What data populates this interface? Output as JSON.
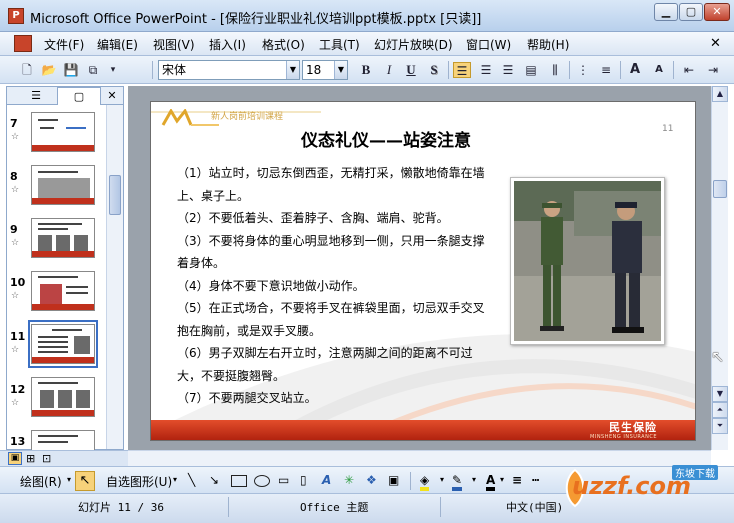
{
  "window": {
    "title": "Microsoft Office PowerPoint - [保险行业职业礼仪培训ppt模板.pptx [只读]]",
    "app_icon": "P"
  },
  "menu": {
    "items": [
      "文件(F)",
      "编辑(E)",
      "视图(V)",
      "插入(I)",
      "格式(O)",
      "工具(T)",
      "幻灯片放映(D)",
      "窗口(W)",
      "帮助(H)"
    ]
  },
  "toolbar": {
    "font_name": "宋体",
    "font_size": "18",
    "bold": "B",
    "italic": "I",
    "underline": "U",
    "shadow": "S",
    "grow_font": "A",
    "shrink_font": "A"
  },
  "left_pane": {
    "tab_outline": "☰",
    "tab_slides": "▢",
    "slides": [
      {
        "num": "7",
        "star": "☆"
      },
      {
        "num": "8",
        "star": "☆"
      },
      {
        "num": "9",
        "star": "☆"
      },
      {
        "num": "10",
        "star": "☆"
      },
      {
        "num": "11",
        "star": "☆"
      },
      {
        "num": "12",
        "star": "☆"
      },
      {
        "num": "13",
        "star": ""
      }
    ]
  },
  "slide": {
    "header_text": "新人岗前培训课程",
    "title": "仪态礼仪——站姿注意",
    "page_number": "11",
    "body": [
      "（1）站立时，切忌东倒西歪，无精打采，懒散地倚靠在墙上、桌子上。",
      "（2）不要低着头、歪着脖子、含胸、端肩、驼背。",
      "（3）不要将身体的重心明显地移到一侧，只用一条腿支撑着身体。",
      "（4）身体不要下意识地做小动作。",
      "（5）在正式场合，不要将手叉在裤袋里面，切忌双手交叉抱在胸前，或是双手叉腰。",
      "（6）男子双脚左右开立时，注意两脚之间的距离不可过大，不要挺腹翘臀。",
      "（7）不要两腿交叉站立。"
    ],
    "footer_logo": "民生保险",
    "footer_sub": "MINSHENG INSURANCE"
  },
  "drawing_toolbar": {
    "draw_label": "绘图(R)",
    "autoshapes_label": "自选图形(U)"
  },
  "status": {
    "slide_counter": "幻灯片 11 / 36",
    "theme": "Office 主题",
    "language": "中文(中国)"
  },
  "watermark": {
    "text": "uzzf.com",
    "sub": "东坡下载"
  },
  "colors": {
    "accent_red": "#c0301c",
    "selection_blue": "#3b6fc4"
  }
}
